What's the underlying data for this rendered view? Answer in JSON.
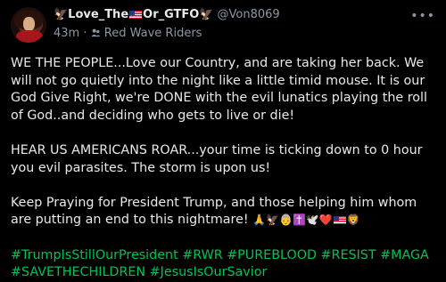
{
  "account": {
    "display_name_prefix": "🦅Love_The",
    "display_name_suffix": "Or_GTFO🦅",
    "handle": "@Von8069",
    "time": "43m",
    "separator": "·",
    "group_icon": "group-icon",
    "group": "Red Wave Riders"
  },
  "more_label": "•••",
  "post": {
    "paragraph1": "WE THE PEOPLE...Love our Country, and are taking her back. We will not go quietly into the night like a little timid mouse. It is our God Give Right, we're DONE with the evil lunatics playing the roll of God..and deciding who gets to live or die!",
    "paragraph2": "HEAR US AMERICANS ROAR...your time is ticking down to 0 hour you evil parasites. The storm is upon us!",
    "paragraph3": "Keep Praying for President Trump, and those helping him whom are putting an end to this nightmare!",
    "emojis_before_flag": "🙏🦅👵✝️🕊️❤️",
    "emojis_after_flag": "🦁",
    "hashtags_line1": "#TrumpIsStillOurPresident #RWR #PUREBLOOD #RESIST #MAGA",
    "hashtags_line2": "#SAVETHECHILDREN #JesusIsOurSavior"
  }
}
